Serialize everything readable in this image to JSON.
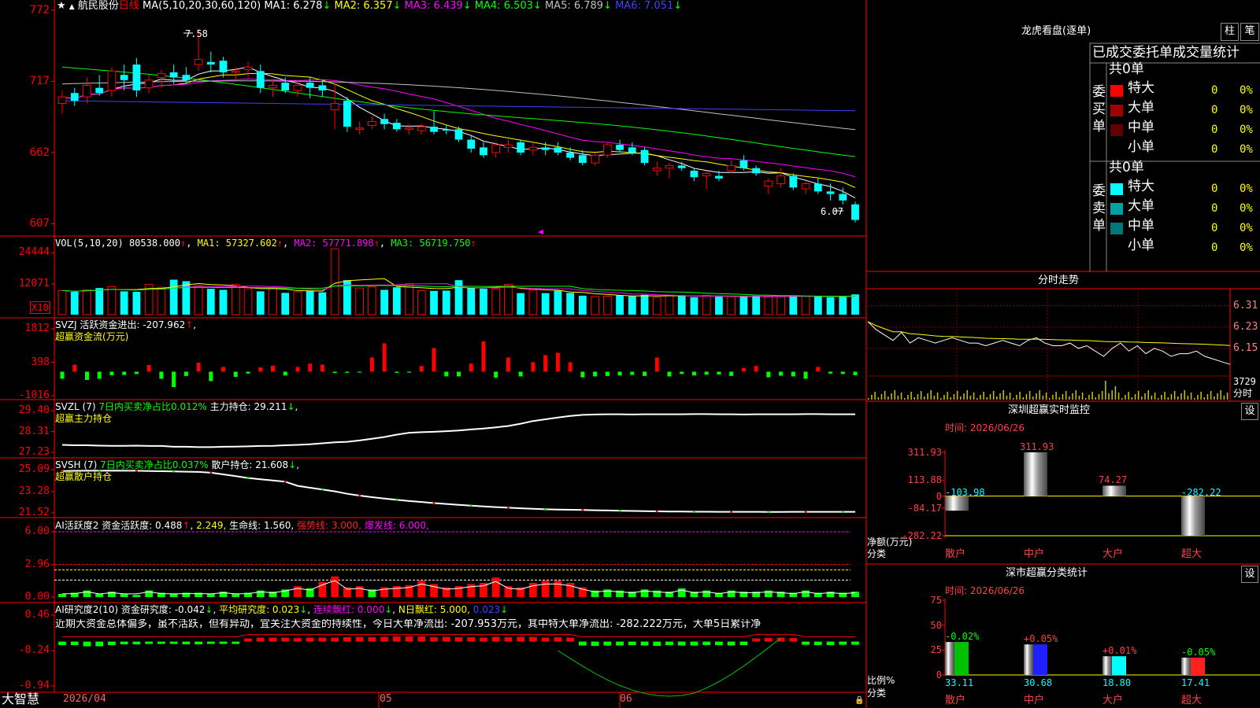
{
  "header": {
    "stock": "航民股份",
    "period": "日线",
    "ma_params": "MA(5,10,20,30,60,120)",
    "ma": [
      {
        "label": "MA1:",
        "value": "6.278↓",
        "color": "#ffffff"
      },
      {
        "label": "MA2:",
        "value": "6.357↓",
        "color": "#ffff00"
      },
      {
        "label": "MA3:",
        "value": "6.439↓",
        "color": "#ff00ff"
      },
      {
        "label": "MA4:",
        "value": "6.503↓",
        "color": "#00ff00"
      },
      {
        "label": "MA5:",
        "value": "6.789↓",
        "color": "#c0c0c0"
      },
      {
        "label": "MA6:",
        "value": "7.051↓",
        "color": "#4040ff"
      }
    ]
  },
  "price_axis": {
    "ticks": [
      "772",
      "717",
      "662",
      "607"
    ],
    "high_label": "7.58",
    "low_label": "6.07"
  },
  "vol": {
    "text": "VOL(5,10,20)",
    "value": "80538.000",
    "ma1": "MA1: 57327.602",
    "ma2": "MA2: 57771.898",
    "ma3": "MA3: 56719.750",
    "ticks": [
      "24444",
      "12071"
    ],
    "unit": "X10"
  },
  "svzj": {
    "title": "SVZJ  活跃资金进出: -207.962",
    "sub": "超赢资金流(万元)",
    "ticks": [
      "1812",
      "398",
      "-1016"
    ]
  },
  "svzl": {
    "title": "SVZL (7)",
    "green": "7日内买卖净占比0.012%",
    "white": "主力持仓: 29.211",
    "sub": "超赢主力持仓",
    "ticks": [
      "29.40",
      "28.31",
      "27.23"
    ]
  },
  "svsh": {
    "title": "SVSH (7)",
    "green": "7日内买卖净占比0.037%",
    "white": "散户持仓: 21.608",
    "sub": "超赢散户持仓",
    "ticks": [
      "25.09",
      "23.28",
      "21.52"
    ]
  },
  "ai1": {
    "title": "AI活跃度2 资金活跃度: 0.488",
    "v2": "2.249,",
    "v3": "生命线: 1.560,",
    "v4": "强势线: 3.000,",
    "v5": "爆发线: 6.000,",
    "ticks": [
      "6.00",
      "2.96",
      "0.00"
    ]
  },
  "ai2": {
    "title": "AI研究度2(10) 资金研究度: -0.042",
    "v2": "平均研究度: 0.023",
    "v3": "连续飘红: 0.000",
    "v4": "N日飘红: 5.000,",
    "v5": "0.023",
    "text": "近期大资金总体偏多，虽不活跃，但有异动，宜关注大资金的持续性，今日大单净流出: -207.953万元，其中特大单净流出: -282.222万元，大单5日累计净",
    "ticks": [
      "0.46",
      "-0.24",
      "-0.94"
    ]
  },
  "date_axis": {
    "labels": [
      "2026/04",
      "05",
      "06"
    ]
  },
  "brand": "大智慧",
  "right": {
    "lhb_title": "龙虎看盘(逐单)",
    "btn_zhu": "柱",
    "btn_bi": "笔",
    "table_header": "已成交委托单成交量统计",
    "buy_label": "委买单",
    "sell_label": "委卖单",
    "buy_total": "共0单",
    "sell_total": "共0单",
    "buy_rows": [
      {
        "name": "特大",
        "count": "0",
        "pct": "0%",
        "color": "#ff0000"
      },
      {
        "name": "大单",
        "count": "0",
        "pct": "0%",
        "color": "#a00000"
      },
      {
        "name": "中单",
        "count": "0",
        "pct": "0%",
        "color": "#600000"
      },
      {
        "name": "小单",
        "count": "0",
        "pct": "0%",
        "color": ""
      }
    ],
    "sell_rows": [
      {
        "name": "特大",
        "count": "0",
        "pct": "0%",
        "color": "#00ffff"
      },
      {
        "name": "大单",
        "count": "0",
        "pct": "0%",
        "color": "#00a0a0"
      },
      {
        "name": "中单",
        "count": "0",
        "pct": "0%",
        "color": "#007878"
      },
      {
        "name": "小单",
        "count": "0",
        "pct": "0%",
        "color": ""
      }
    ],
    "intraday_title": "分时走势",
    "intraday_ticks": [
      "6.31",
      "6.23",
      "6.15"
    ],
    "intraday_vol": "3729",
    "intraday_unit": "分时",
    "sz_monitor_title": "深圳超赢实时监控",
    "sz_time": "时间: 2026/06/26",
    "sz_ticks": [
      "311.93",
      "113.88",
      "0",
      "-84.17",
      "-282.22"
    ],
    "sz_ylabel": "净额(万元)",
    "sz_xlabel": "分类",
    "sz_values": [
      {
        "cat": "散户",
        "value": "-103.98"
      },
      {
        "cat": "中户",
        "value": "311.93"
      },
      {
        "cat": "大户",
        "value": "74.27"
      },
      {
        "cat": "超大",
        "value": "-282.22"
      }
    ],
    "sh_title": "深市超赢分类统计",
    "sh_time": "时间: 2026/06/26",
    "sh_ticks": [
      "75",
      "50",
      "25",
      "0"
    ],
    "sh_ylabel": "比例%",
    "sh_xlabel": "分类",
    "sh_values": [
      {
        "cat": "散户",
        "value": "33.11",
        "delta": "-0.02%",
        "color": "#00c000"
      },
      {
        "cat": "中户",
        "value": "30.68",
        "delta": "+0.05%",
        "color": "#2020ff"
      },
      {
        "cat": "大户",
        "value": "18.80",
        "delta": "+0.01%",
        "color": "#00ffff"
      },
      {
        "cat": "超大",
        "value": "17.41",
        "delta": "-0.05%",
        "color": "#ff2020"
      }
    ],
    "set_btn": "设"
  },
  "chart_data": [
    {
      "type": "candlestick",
      "title": "航民股份 日线",
      "ylim": [
        6.0,
        7.75
      ],
      "candles": [
        [
          7.0,
          7.1,
          6.92,
          7.05
        ],
        [
          7.08,
          7.12,
          6.98,
          7.02
        ],
        [
          7.05,
          7.2,
          7.0,
          7.14
        ],
        [
          7.12,
          7.22,
          7.06,
          7.08
        ],
        [
          7.1,
          7.28,
          7.05,
          7.25
        ],
        [
          7.22,
          7.3,
          7.1,
          7.18
        ],
        [
          7.3,
          7.35,
          7.05,
          7.1
        ],
        [
          7.12,
          7.22,
          7.08,
          7.18
        ],
        [
          7.2,
          7.26,
          7.12,
          7.23
        ],
        [
          7.24,
          7.3,
          7.15,
          7.2
        ],
        [
          7.22,
          7.28,
          7.15,
          7.18
        ],
        [
          7.3,
          7.58,
          7.25,
          7.34
        ],
        [
          7.32,
          7.4,
          7.24,
          7.3
        ],
        [
          7.33,
          7.36,
          7.2,
          7.24
        ],
        [
          7.24,
          7.28,
          7.18,
          7.25
        ],
        [
          7.26,
          7.32,
          7.2,
          7.28
        ],
        [
          7.25,
          7.3,
          7.08,
          7.12
        ],
        [
          7.12,
          7.18,
          7.05,
          7.14
        ],
        [
          7.16,
          7.2,
          7.08,
          7.1
        ],
        [
          7.1,
          7.18,
          7.05,
          7.14
        ],
        [
          7.16,
          7.2,
          7.04,
          7.12
        ],
        [
          7.14,
          7.18,
          7.05,
          7.1
        ],
        [
          6.95,
          7.15,
          6.8,
          7.0
        ],
        [
          7.02,
          7.05,
          6.78,
          6.82
        ],
        [
          6.8,
          6.86,
          6.76,
          6.81
        ],
        [
          6.83,
          6.9,
          6.8,
          6.86
        ],
        [
          6.88,
          6.92,
          6.8,
          6.84
        ],
        [
          6.85,
          6.88,
          6.78,
          6.8
        ],
        [
          6.8,
          6.84,
          6.76,
          6.81
        ],
        [
          6.79,
          6.84,
          6.76,
          6.82
        ],
        [
          6.82,
          6.94,
          6.76,
          6.78
        ],
        [
          6.8,
          6.83,
          6.76,
          6.79
        ],
        [
          6.8,
          6.82,
          6.7,
          6.72
        ],
        [
          6.72,
          6.75,
          6.62,
          6.65
        ],
        [
          6.66,
          6.7,
          6.58,
          6.6
        ],
        [
          6.62,
          6.7,
          6.58,
          6.68
        ],
        [
          6.66,
          6.72,
          6.62,
          6.68
        ],
        [
          6.7,
          6.72,
          6.6,
          6.62
        ],
        [
          6.64,
          6.7,
          6.6,
          6.66
        ],
        [
          6.66,
          6.7,
          6.6,
          6.64
        ],
        [
          6.66,
          6.7,
          6.6,
          6.62
        ],
        [
          6.62,
          6.66,
          6.56,
          6.58
        ],
        [
          6.6,
          6.64,
          6.52,
          6.54
        ],
        [
          6.54,
          6.62,
          6.52,
          6.6
        ],
        [
          6.6,
          6.7,
          6.58,
          6.68
        ],
        [
          6.68,
          6.72,
          6.62,
          6.64
        ],
        [
          6.66,
          6.7,
          6.6,
          6.62
        ],
        [
          6.64,
          6.66,
          6.52,
          6.54
        ],
        [
          6.48,
          6.55,
          6.44,
          6.5
        ],
        [
          6.5,
          6.54,
          6.42,
          6.52
        ],
        [
          6.52,
          6.55,
          6.48,
          6.5
        ],
        [
          6.48,
          6.5,
          6.4,
          6.43
        ],
        [
          6.44,
          6.48,
          6.34,
          6.46
        ],
        [
          6.44,
          6.48,
          6.4,
          6.42
        ],
        [
          6.48,
          6.56,
          6.46,
          6.52
        ],
        [
          6.56,
          6.6,
          6.48,
          6.5
        ],
        [
          6.5,
          6.52,
          6.44,
          6.46
        ],
        [
          6.36,
          6.42,
          6.3,
          6.4
        ],
        [
          6.38,
          6.5,
          6.35,
          6.44
        ],
        [
          6.44,
          6.46,
          6.33,
          6.35
        ],
        [
          6.34,
          6.4,
          6.3,
          6.38
        ],
        [
          6.38,
          6.42,
          6.3,
          6.32
        ],
        [
          6.32,
          6.38,
          6.25,
          6.3
        ],
        [
          6.3,
          6.35,
          6.22,
          6.25
        ],
        [
          6.22,
          6.24,
          6.08,
          6.1
        ]
      ]
    },
    {
      "type": "bar",
      "title": "VOL",
      "ylim": [
        0,
        27000
      ],
      "values": [
        9500,
        9000,
        9800,
        10500,
        11000,
        9200,
        9000,
        12000,
        10800,
        13800,
        13200,
        11500,
        10200,
        9800,
        12000,
        10200,
        9200,
        10500,
        8600,
        9000,
        9500,
        8800,
        26000,
        13600,
        10500,
        11000,
        9800,
        10800,
        12200,
        9500,
        9400,
        9500,
        13600,
        10600,
        10300,
        10200,
        12000,
        8500,
        9700,
        8500,
        9500,
        8600,
        7500,
        7200,
        7300,
        7600,
        7300,
        7800,
        6800,
        7700,
        7700,
        6900,
        7600,
        7100,
        7200,
        7000,
        7500,
        7100,
        7200,
        7400,
        7300,
        7300,
        6900,
        7000,
        8000
      ]
    },
    {
      "type": "bar",
      "title": "SVZJ",
      "ylim": [
        -1016,
        1812
      ],
      "values": [
        -300,
        300,
        -350,
        -300,
        -150,
        -140,
        -100,
        280,
        -300,
        -650,
        -180,
        380,
        -400,
        200,
        -220,
        -80,
        180,
        250,
        -160,
        200,
        340,
        300,
        -60,
        -50,
        -40,
        600,
        1200,
        -50,
        -40,
        240,
        1000,
        -200,
        -200,
        340,
        1280,
        -260,
        600,
        -200,
        400,
        700,
        800,
        400,
        -240,
        -200,
        -180,
        -160,
        -140,
        -180,
        600,
        -200,
        -100,
        -160,
        -130,
        -120,
        -180,
        160,
        240,
        -240,
        -170,
        -200,
        -300,
        200,
        -80,
        -100,
        -150
      ]
    },
    {
      "type": "line",
      "title": "SVZL",
      "ylim": [
        27.23,
        29.4
      ],
      "values": [
        27.62,
        27.6,
        27.6,
        27.58,
        27.57,
        27.57,
        27.58,
        27.56,
        27.56,
        27.52,
        27.52,
        27.5,
        27.5,
        27.52,
        27.53,
        27.54,
        27.56,
        27.57,
        27.6,
        27.62,
        27.65,
        27.7,
        27.75,
        27.78,
        27.85,
        27.94,
        28.03,
        28.15,
        28.25,
        28.28,
        28.3,
        28.33,
        28.37,
        28.42,
        28.47,
        28.53,
        28.6,
        28.72,
        28.86,
        28.95,
        29.04,
        29.12,
        29.18,
        29.2,
        29.21,
        29.21,
        29.2,
        29.21,
        29.21,
        29.21,
        29.21,
        29.22,
        29.22,
        29.21,
        29.21,
        29.2,
        29.21,
        29.21,
        29.21,
        29.21,
        29.22,
        29.22,
        29.21,
        29.21,
        29.21
      ]
    },
    {
      "type": "line",
      "title": "SVSH",
      "ylim": [
        21.52,
        25.09
      ],
      "values": [
        24.98,
        24.99,
        25.0,
        25.0,
        25.01,
        25.0,
        25.0,
        24.98,
        24.96,
        24.95,
        24.92,
        24.9,
        24.84,
        24.7,
        24.55,
        24.4,
        24.3,
        24.2,
        24.1,
        23.75,
        23.6,
        23.45,
        23.3,
        23.1,
        22.95,
        22.82,
        22.7,
        22.6,
        22.5,
        22.42,
        22.33,
        22.26,
        22.18,
        22.12,
        22.06,
        22.0,
        21.95,
        21.9,
        21.86,
        21.82,
        21.8,
        21.78,
        21.76,
        21.74,
        21.72,
        21.7,
        21.68,
        21.66,
        21.65,
        21.64,
        21.63,
        21.62,
        21.62,
        21.61,
        21.61,
        21.61,
        21.61,
        21.6,
        21.6,
        21.61,
        21.61,
        21.61,
        21.61,
        21.61,
        21.61
      ]
    },
    {
      "type": "bar",
      "title": "AI活跃度2",
      "ylim": [
        0,
        6.0
      ],
      "lines": [
        {
          "name": "强势线",
          "value": 3.0
        },
        {
          "name": "爆发线",
          "value": 6.0
        }
      ],
      "values": [
        0.3,
        0.4,
        0.6,
        0.3,
        0.5,
        0.3,
        0.2,
        0.6,
        0.4,
        0.3,
        0.4,
        0.4,
        0.3,
        0.5,
        0.3,
        0.4,
        0.6,
        0.5,
        0.7,
        1.0,
        0.8,
        1.4,
        1.9,
        0.9,
        1.0,
        0.7,
        0.9,
        1.0,
        1.1,
        1.5,
        1.2,
        0.9,
        1.0,
        1.2,
        1.3,
        1.8,
        1.0,
        0.9,
        1.3,
        1.5,
        1.5,
        1.3,
        0.9,
        0.6,
        0.7,
        0.6,
        0.5,
        0.7,
        0.6,
        0.5,
        0.8,
        0.5,
        0.6,
        0.4,
        0.6,
        0.5,
        0.5,
        0.6,
        0.5,
        0.4,
        0.6,
        0.4,
        0.5,
        0.4,
        0.5
      ]
    },
    {
      "type": "bar",
      "title": "AI研究度2(10)",
      "ylim": [
        -0.94,
        0.46
      ],
      "values": [
        -0.05,
        -0.05,
        -0.08,
        -0.08,
        -0.05,
        -0.03,
        -0.03,
        -0.02,
        -0.02,
        -0.02,
        -0.03,
        -0.03,
        -0.02,
        -0.02,
        -0.02,
        0.04,
        0.06,
        0.06,
        0.06,
        0.05,
        0.06,
        0.06,
        0.06,
        0.07,
        0.08,
        0.07,
        0.08,
        0.09,
        0.09,
        0.09,
        0.07,
        0.08,
        0.07,
        0.07,
        0.06,
        0.08,
        0.07,
        0.08,
        0.08,
        0.06,
        0.07,
        0.06,
        -0.06,
        -0.07,
        -0.06,
        -0.06,
        -0.05,
        -0.06,
        -0.07,
        -0.05,
        -0.06,
        -0.06,
        -0.05,
        -0.05,
        -0.06,
        -0.05,
        0.04,
        0.05,
        0.06,
        0.05,
        -0.04,
        -0.05,
        -0.05,
        -0.04,
        -0.04
      ]
    },
    {
      "type": "line",
      "title": "分时走势",
      "ylim": [
        6.07,
        6.35
      ],
      "values": [
        6.25,
        6.22,
        6.2,
        6.18,
        6.21,
        6.17,
        6.19,
        6.18,
        6.17,
        6.18,
        6.19,
        6.18,
        6.17,
        6.17,
        6.16,
        6.17,
        6.18,
        6.17,
        6.16,
        6.18,
        6.19,
        6.17,
        6.16,
        6.16,
        6.17,
        6.15,
        6.16,
        6.14,
        6.12,
        6.15,
        6.17,
        6.14,
        6.16,
        6.13,
        6.15,
        6.14,
        6.12,
        6.13,
        6.13,
        6.14,
        6.12,
        6.11,
        6.1,
        6.09
      ]
    },
    {
      "type": "bar",
      "title": "深圳超赢实时监控",
      "categories": [
        "散户",
        "中户",
        "大户",
        "超大"
      ],
      "values": [
        -103.98,
        311.93,
        74.27,
        -282.22
      ],
      "ylim": [
        -282.22,
        311.93
      ]
    },
    {
      "type": "bar",
      "title": "深市超赢分类统计",
      "categories": [
        "散户",
        "中户",
        "大户",
        "超大"
      ],
      "values": [
        33.11,
        30.68,
        18.8,
        17.41
      ],
      "ylim": [
        0,
        75
      ]
    }
  ]
}
